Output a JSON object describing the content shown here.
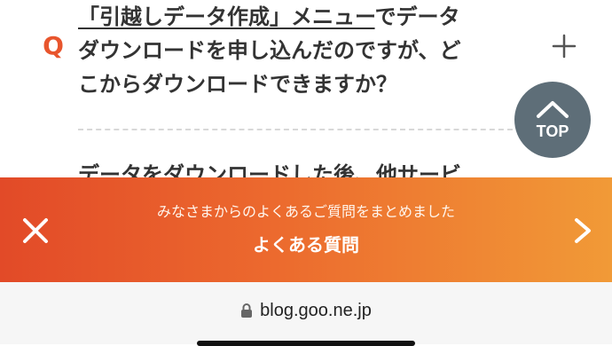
{
  "faq": {
    "question_link": "「引越しデータ作成」メニュー",
    "question_line1_rest": "でデータ",
    "question_line2": "ダウンロードを申し込んだのですが、ど",
    "question_line3": "こからダウンロードできますか？",
    "q_label": "Q",
    "next_question": "データをダウンロードした後、他サービ"
  },
  "top_button": {
    "label": "TOP"
  },
  "banner": {
    "subtitle": "みなさまからのよくあるご質問をまとめました",
    "title": "よくある質問"
  },
  "browser": {
    "url": "blog.goo.ne.jp"
  },
  "colors": {
    "accent": "#e8552d",
    "banner_start": "#e24a28",
    "banner_end": "#f19a37",
    "top_button": "#5e6e78"
  },
  "icons": {
    "expand": "plus-icon",
    "close": "close-icon",
    "next": "chevron-right-icon",
    "lock": "lock-icon",
    "top": "chevron-up-icon"
  }
}
